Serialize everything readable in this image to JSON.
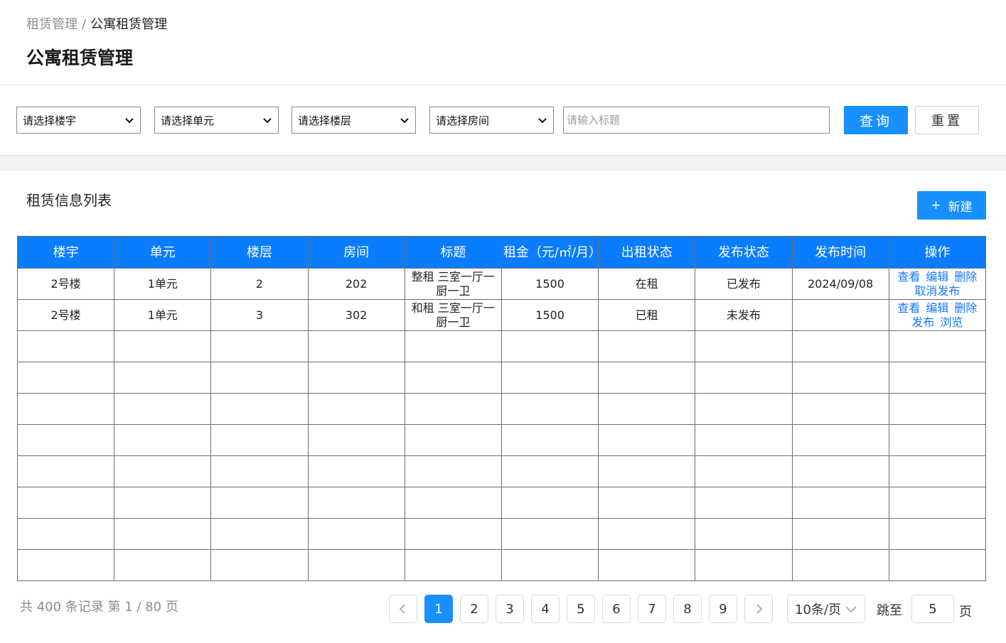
{
  "breadcrumb": {
    "parent": "租赁管理",
    "separator": "/",
    "current": "公寓租赁管理"
  },
  "page_title": "公寓租赁管理",
  "filters": {
    "building": "请选择楼宇",
    "unit": "请选择单元",
    "floor": "请选择楼层",
    "room": "请选择房间",
    "title_placeholder": "请输入标题",
    "query_label": "查询",
    "reset_label": "重置"
  },
  "list": {
    "title": "租赁信息列表",
    "new_plus": "+",
    "new_label": "新建"
  },
  "table": {
    "headers": [
      "楼宇",
      "单元",
      "楼层",
      "房间",
      "标题",
      "租金（元/㎡/月）",
      "出租状态",
      "发布状态",
      "发布时间",
      "操作"
    ],
    "rows": [
      {
        "building": "2号楼",
        "unit": "1单元",
        "floor": "2",
        "room": "202",
        "title": "整租 三室一厅一厨一卫",
        "rent": "1500",
        "rent_status": "在租",
        "publish_status": "已发布",
        "publish_time": "2024/09/08",
        "actions": [
          "查看",
          "编辑",
          "删除",
          "取消发布"
        ]
      },
      {
        "building": "2号楼",
        "unit": "1单元",
        "floor": "3",
        "room": "302",
        "title": "和租 三室一厅一厨一卫",
        "rent": "1500",
        "rent_status": "已租",
        "publish_status": "未发布",
        "publish_time": "",
        "actions": [
          "查看",
          "编辑",
          "删除",
          "发布",
          "浏览"
        ]
      }
    ]
  },
  "footer": {
    "record_info": "共 400 条记录 第 1 / 80 页",
    "pages": [
      "1",
      "2",
      "3",
      "4",
      "5",
      "6",
      "7",
      "8",
      "9"
    ],
    "current_page": "1",
    "page_size": "10条/页",
    "jump_label": "跳至",
    "jump_value": "5",
    "jump_suffix": "页"
  },
  "colors": {
    "primary": "#1890ff",
    "header_bg": "#0a7cff",
    "link": "#1677ff"
  },
  "icons": [
    "chevron-down-icon",
    "chevron-left-icon",
    "chevron-right-icon",
    "plus-icon"
  ]
}
